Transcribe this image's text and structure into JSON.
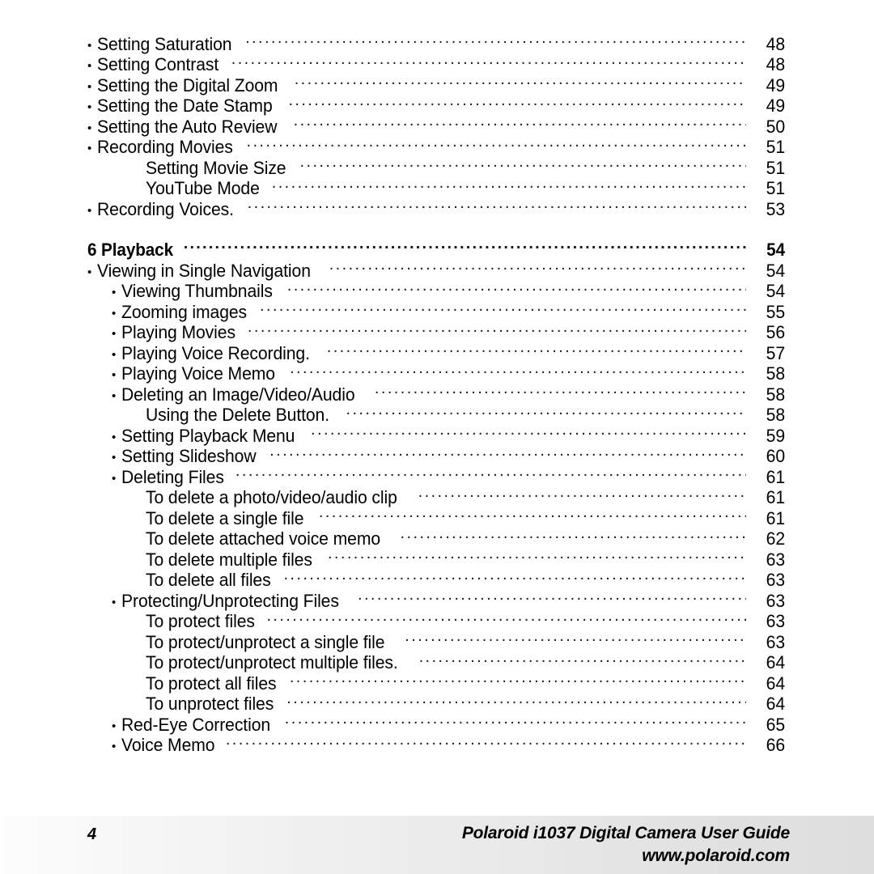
{
  "document": {
    "type": "table-of-contents",
    "page_number": "4"
  },
  "toc": {
    "bullet_glyph": "•",
    "entries": [
      {
        "label": "Setting Saturation",
        "page": "48",
        "level": 0,
        "bullet": true,
        "section": false
      },
      {
        "label": "Setting Contrast",
        "page": "48",
        "level": 0,
        "bullet": true,
        "section": false
      },
      {
        "label": "Setting the Digital Zoom",
        "page": "49",
        "level": 0,
        "bullet": true,
        "section": false
      },
      {
        "label": "Setting the Date Stamp",
        "page": "49",
        "level": 0,
        "bullet": true,
        "section": false
      },
      {
        "label": "Setting the Auto Review",
        "page": "50",
        "level": 0,
        "bullet": true,
        "section": false
      },
      {
        "label": "Recording Movies",
        "page": "51",
        "level": 0,
        "bullet": true,
        "section": false
      },
      {
        "label": "Setting Movie Size",
        "page": "51",
        "level": 2,
        "bullet": false,
        "section": false
      },
      {
        "label": "YouTube Mode",
        "page": "51",
        "level": 2,
        "bullet": false,
        "section": false
      },
      {
        "label": "Recording Voices.",
        "page": "53",
        "level": 0,
        "bullet": true,
        "section": false
      },
      {
        "label": "6 Playback",
        "page": "54",
        "level": 0,
        "bullet": false,
        "section": true
      },
      {
        "label": "Viewing in Single Navigation",
        "page": "54",
        "level": 0,
        "bullet": true,
        "section": false
      },
      {
        "label": "Viewing Thumbnails",
        "page": "54",
        "level": 1,
        "bullet": true,
        "section": false
      },
      {
        "label": "Zooming images",
        "page": "55",
        "level": 1,
        "bullet": true,
        "section": false
      },
      {
        "label": "Playing Movies",
        "page": "56",
        "level": 1,
        "bullet": true,
        "section": false
      },
      {
        "label": "Playing Voice Recording.",
        "page": "57",
        "level": 1,
        "bullet": true,
        "section": false
      },
      {
        "label": "Playing Voice Memo",
        "page": "58",
        "level": 1,
        "bullet": true,
        "section": false
      },
      {
        "label": "Deleting an Image/Video/Audio",
        "page": "58",
        "level": 1,
        "bullet": true,
        "section": false
      },
      {
        "label": "Using the Delete Button.",
        "page": "58",
        "level": 2,
        "bullet": false,
        "section": false
      },
      {
        "label": "Setting Playback Menu",
        "page": "59",
        "level": 1,
        "bullet": true,
        "section": false
      },
      {
        "label": "Setting Slideshow",
        "page": "60",
        "level": 1,
        "bullet": true,
        "section": false
      },
      {
        "label": "Deleting Files",
        "page": "61",
        "level": 1,
        "bullet": true,
        "section": false
      },
      {
        "label": "To delete a photo/video/audio clip",
        "page": "61",
        "level": 2,
        "bullet": false,
        "section": false
      },
      {
        "label": "To delete a single file",
        "page": "61",
        "level": 2,
        "bullet": false,
        "section": false
      },
      {
        "label": "To delete attached voice memo",
        "page": "62",
        "level": 2,
        "bullet": false,
        "section": false
      },
      {
        "label": "To delete multiple files",
        "page": "63",
        "level": 2,
        "bullet": false,
        "section": false
      },
      {
        "label": "To delete all files",
        "page": "63",
        "level": 2,
        "bullet": false,
        "section": false
      },
      {
        "label": "Protecting/Unprotecting Files",
        "page": "63",
        "level": 1,
        "bullet": true,
        "section": false
      },
      {
        "label": "To protect files",
        "page": "63",
        "level": 2,
        "bullet": false,
        "section": false
      },
      {
        "label": "To protect/unprotect a single file",
        "page": "63",
        "level": 2,
        "bullet": false,
        "section": false
      },
      {
        "label": "To protect/unprotect multiple files.",
        "page": "64",
        "level": 2,
        "bullet": false,
        "section": false
      },
      {
        "label": "To protect all files",
        "page": "64",
        "level": 2,
        "bullet": false,
        "section": false
      },
      {
        "label": "To unprotect files",
        "page": "64",
        "level": 2,
        "bullet": false,
        "section": false
      },
      {
        "label": "Red-Eye Correction",
        "page": "65",
        "level": 1,
        "bullet": true,
        "section": false
      },
      {
        "label": "Voice Memo",
        "page": "66",
        "level": 1,
        "bullet": true,
        "section": false
      }
    ]
  },
  "footer": {
    "page_number": "4",
    "title": "Polaroid i1037 Digital Camera User Guide",
    "website": "www.polaroid.com"
  },
  "colors": {
    "text": "#000000",
    "background": "#ffffff",
    "footer_gradient_start": "#fdfdfd",
    "footer_gradient_end": "#dedede"
  }
}
